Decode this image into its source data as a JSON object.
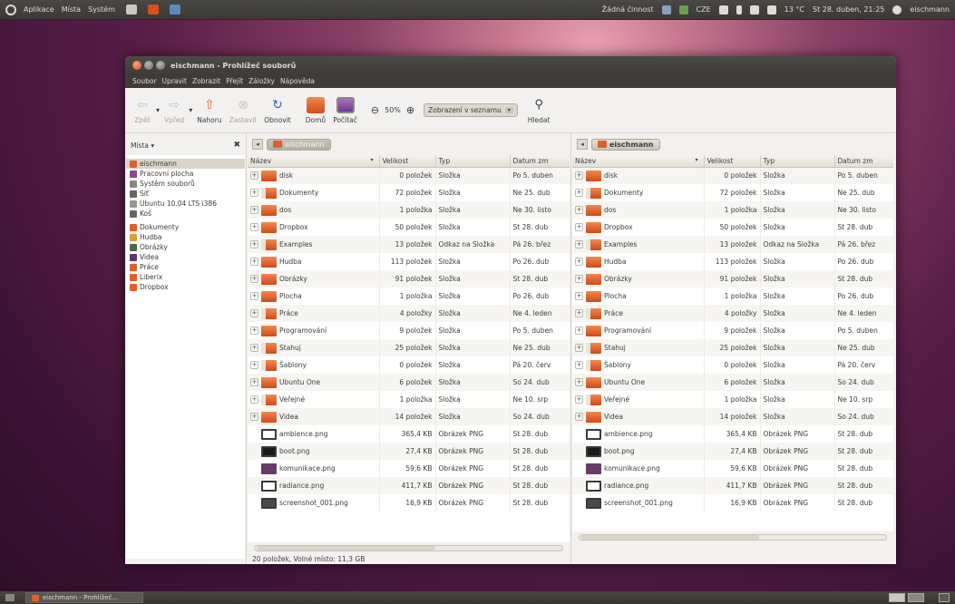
{
  "top_panel": {
    "menus": [
      "Aplikace",
      "Místa",
      "Systém"
    ],
    "activity": "Žádná činnost",
    "keyboard": "CZE",
    "weather": "13 °C",
    "datetime": "St 28. duben, 21:25",
    "user": "eischmann"
  },
  "window": {
    "title": "eischmann - Prohlížeč souborů",
    "menus": [
      "Soubor",
      "Upravit",
      "Zobrazit",
      "Přejít",
      "Záložky",
      "Nápověda"
    ]
  },
  "toolbar": {
    "back": "Zpět",
    "forward": "Vpřed",
    "up": "Nahoru",
    "stop": "Zastavit",
    "reload": "Obnovit",
    "home": "Domů",
    "computer": "Počítač",
    "zoom_level": "50%",
    "view_mode": "Zobrazení v seznamu",
    "search": "Hledat"
  },
  "sidebar": {
    "title": "Místa",
    "close": "✖",
    "items": [
      {
        "label": "eischmann",
        "icon": "home-folder-icon",
        "color": "#e0602a"
      },
      {
        "label": "Pracovní plocha",
        "icon": "desktop-icon",
        "color": "#8a4a8a"
      },
      {
        "label": "Systém souborů",
        "icon": "drive-icon",
        "color": "#8a8780"
      },
      {
        "label": "Síť",
        "icon": "network-icon",
        "color": "#6a6760"
      },
      {
        "label": "Ubuntu 10.04 LTS i386",
        "icon": "cdrom-icon",
        "color": "#9a9790"
      },
      {
        "label": "Koš",
        "icon": "trash-icon",
        "color": "#6a6760"
      },
      {
        "label": "Dokumenty",
        "icon": "documents-folder-icon",
        "color": "#e0602a"
      },
      {
        "label": "Hudba",
        "icon": "music-folder-icon",
        "color": "#d8a030"
      },
      {
        "label": "Obrázky",
        "icon": "pictures-folder-icon",
        "color": "#4a6a4a"
      },
      {
        "label": "Videa",
        "icon": "videos-folder-icon",
        "color": "#5a3a6a"
      },
      {
        "label": "Práce",
        "icon": "folder-icon",
        "color": "#e0602a"
      },
      {
        "label": "Liberix",
        "icon": "folder-icon",
        "color": "#e0602a"
      },
      {
        "label": "Dropbox",
        "icon": "folder-icon",
        "color": "#e0602a"
      }
    ]
  },
  "columns": [
    "Název",
    "Velikost",
    "Typ",
    "Datum zm"
  ],
  "left_pane": {
    "path": "eischmann"
  },
  "right_pane": {
    "path": "eischmann"
  },
  "files": [
    {
      "name": "disk",
      "size": "0 položek",
      "type": "Složka",
      "date": "Po 5. duben",
      "kind": "folder"
    },
    {
      "name": "Dokumenty",
      "size": "72 položek",
      "type": "Složka",
      "date": "Ne 25. dub",
      "kind": "doc"
    },
    {
      "name": "dos",
      "size": "1 položka",
      "type": "Složka",
      "date": "Ne 30. listo",
      "kind": "folder"
    },
    {
      "name": "Dropbox",
      "size": "50 položek",
      "type": "Složka",
      "date": "St 28. dub",
      "kind": "folder"
    },
    {
      "name": "Examples",
      "size": "13 položek",
      "type": "Odkaz na Složka",
      "date": "Pá 26. břez",
      "kind": "doc"
    },
    {
      "name": "Hudba",
      "size": "113 položek",
      "type": "Složka",
      "date": "Po 26. dub",
      "kind": "folder"
    },
    {
      "name": "Obrázky",
      "size": "91 položek",
      "type": "Složka",
      "date": "St 28. dub",
      "kind": "folder"
    },
    {
      "name": "Plocha",
      "size": "1 položka",
      "type": "Složka",
      "date": "Po 26. dub",
      "kind": "folder"
    },
    {
      "name": "Práce",
      "size": "4 položky",
      "type": "Složka",
      "date": "Ne 4. leden",
      "kind": "doc"
    },
    {
      "name": "Programování",
      "size": "9 položek",
      "type": "Složka",
      "date": "Po 5. duben",
      "kind": "folder"
    },
    {
      "name": "Stahuj",
      "size": "25 položek",
      "type": "Složka",
      "date": "Ne 25. dub",
      "kind": "doc"
    },
    {
      "name": "Šablony",
      "size": "0 položek",
      "type": "Složka",
      "date": "Pá 20. červ",
      "kind": "doc"
    },
    {
      "name": "Ubuntu One",
      "size": "6 položek",
      "type": "Složka",
      "date": "So 24. dub",
      "kind": "folder"
    },
    {
      "name": "Veřejné",
      "size": "1 položka",
      "type": "Složka",
      "date": "Ne 10. srp",
      "kind": "doc"
    },
    {
      "name": "Videa",
      "size": "14 položek",
      "type": "Složka",
      "date": "So 24. dub",
      "kind": "folder"
    },
    {
      "name": "ambience.png",
      "size": "365,4 KB",
      "type": "Obrázek PNG",
      "date": "St 28. dub",
      "kind": "img"
    },
    {
      "name": "boot.png",
      "size": "27,4 KB",
      "type": "Obrázek PNG",
      "date": "St 28. dub",
      "kind": "img-dark"
    },
    {
      "name": "komunikace.png",
      "size": "59,6 KB",
      "type": "Obrázek PNG",
      "date": "St 28. dub",
      "kind": "img-purple"
    },
    {
      "name": "radiance.png",
      "size": "411,7 KB",
      "type": "Obrázek PNG",
      "date": "St 28. dub",
      "kind": "img"
    },
    {
      "name": "screenshot_001.png",
      "size": "16,9 KB",
      "type": "Obrázek PNG",
      "date": "St 28. dub",
      "kind": "img-gray"
    }
  ],
  "statusbar": "20 položek, Volné místo: 11,3 GB",
  "taskbar": {
    "label": "eischmann - Prohlížeč..."
  }
}
